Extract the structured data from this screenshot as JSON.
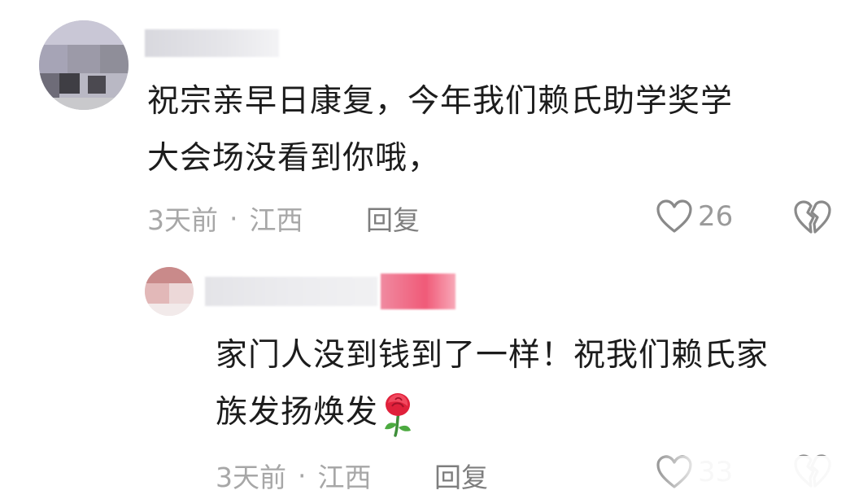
{
  "comment_1": {
    "text_line_1": "祝宗亲早日康复，今年我们赖氏助学奖学",
    "text_line_2": "大会场没看到你哦，",
    "time": "3天前",
    "location": "江西",
    "separator": "·",
    "reply_label": "回复",
    "like_count": "26"
  },
  "comment_2": {
    "text_line_1": "家门人没到钱到了一样！祝我们赖氏家",
    "text_line_2": "族发扬焕发",
    "emoji": "rose",
    "time": "3天前",
    "location": "江西",
    "separator": "·",
    "reply_label": "回复",
    "like_count": "33"
  },
  "icons": {
    "like": "heart-outline-icon",
    "dislike": "broken-heart-outline-icon"
  },
  "colors": {
    "text": "#1c1c1c",
    "meta": "#a7a7a7",
    "icon": "#8a8a8a",
    "username_highlight": "#f05a78"
  }
}
